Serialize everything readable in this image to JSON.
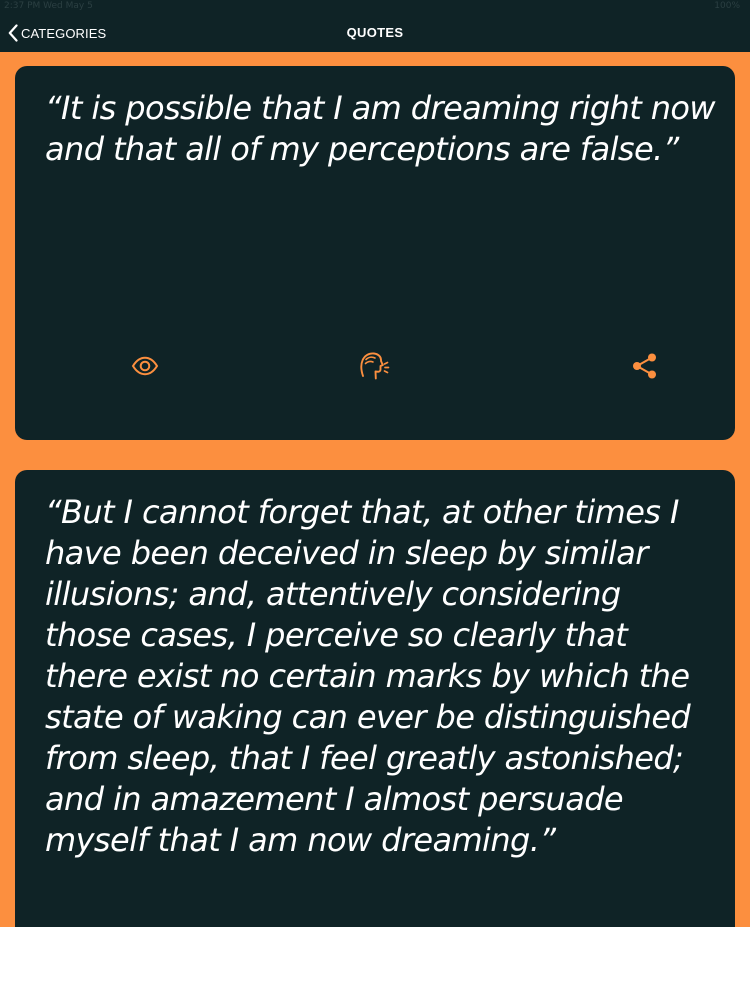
{
  "status_bar": {
    "time": "2:37 PM   Wed May 5",
    "battery": "100%"
  },
  "nav": {
    "back_label": "CATEGORIES",
    "title": "QUOTES"
  },
  "colors": {
    "background": "#fc8f3f",
    "card": "#0f2326",
    "accent": "#fc8f3f",
    "text": "#ffffff"
  },
  "quotes": [
    {
      "text": "“It is possible that I am dreaming right now and that all of my perceptions are false.”",
      "actions": [
        {
          "icon": "eye-icon"
        },
        {
          "icon": "speaking-head-icon"
        },
        {
          "icon": "share-icon"
        }
      ]
    },
    {
      "text": "“But I cannot forget that, at other times I have been deceived in sleep by similar illusions; and, attentively considering those cases, I perceive so clearly that there exist no certain marks by which the state of waking can ever be distinguished from sleep, that I feel greatly astonished; and in amazement I almost persuade myself that I am now dreaming.”"
    }
  ]
}
